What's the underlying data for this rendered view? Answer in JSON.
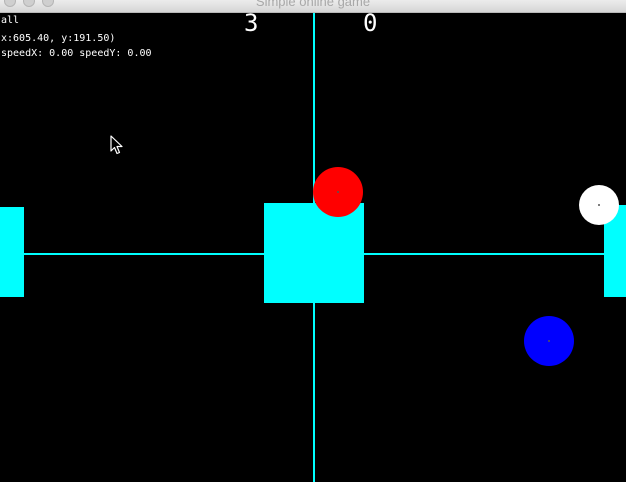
{
  "window": {
    "title": "Simple online game"
  },
  "hud": {
    "mode": "all",
    "position": "x:605.40, y:191.50)",
    "speed": "speedX: 0.00 speedY: 0.00"
  },
  "score": {
    "left": "3",
    "right": "0"
  },
  "colors": {
    "background": "#000000",
    "lines": "#00ffff",
    "blocks": "#00ffff",
    "ball_red": "#ff0000",
    "ball_white": "#ffffff",
    "ball_blue": "#0000ff"
  },
  "icons": {
    "cursor": "arrow-cursor-icon"
  }
}
